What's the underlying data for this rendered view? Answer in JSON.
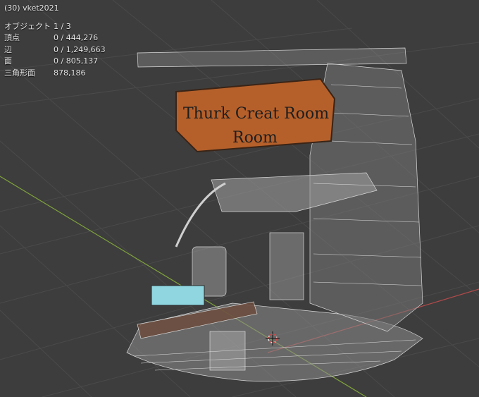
{
  "viewport": {
    "header_text": "(30) vket2021",
    "stats": [
      {
        "label": "オブジェクト",
        "value": "1 / 3"
      },
      {
        "label": "頂点",
        "value": "0 / 444,276"
      },
      {
        "label": "辺",
        "value": "0 / 1,249,663"
      },
      {
        "label": "面",
        "value": "0 / 805,137"
      },
      {
        "label": "三角形面",
        "value": "878,186"
      }
    ],
    "sign_text": {
      "line1": "Thurk Creat Room",
      "line2": "Room"
    }
  },
  "colors": {
    "background": "#3d3d3d",
    "grid": "#4a4a4a",
    "x_axis": "#b34a4a",
    "y_axis": "#7fa33a",
    "wire": "#d8d8d8",
    "sign_wood": "#b5602b",
    "accent_cyan": "#8fd6e0"
  }
}
